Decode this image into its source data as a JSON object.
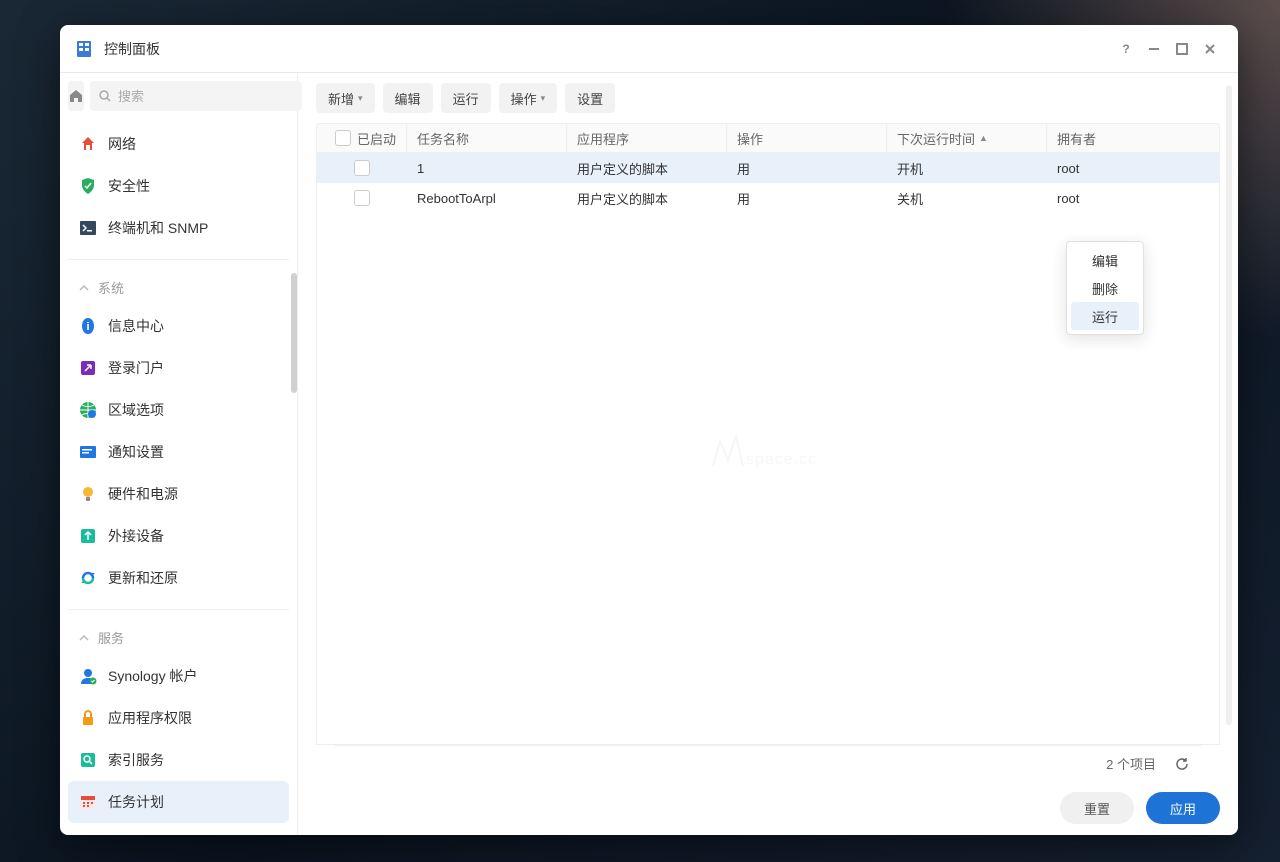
{
  "window": {
    "title": "控制面板"
  },
  "search": {
    "placeholder": "搜索"
  },
  "sidebar": {
    "top": [
      {
        "label": "网络",
        "icon": "home-red"
      },
      {
        "label": "安全性",
        "icon": "shield"
      },
      {
        "label": "终端机和 SNMP",
        "icon": "terminal"
      }
    ],
    "sections": [
      {
        "title": "系统",
        "items": [
          {
            "label": "信息中心",
            "icon": "info"
          },
          {
            "label": "登录门户",
            "icon": "portal"
          },
          {
            "label": "区域选项",
            "icon": "globe"
          },
          {
            "label": "通知设置",
            "icon": "notify"
          },
          {
            "label": "硬件和电源",
            "icon": "bulb"
          },
          {
            "label": "外接设备",
            "icon": "external"
          },
          {
            "label": "更新和还原",
            "icon": "refresh"
          }
        ]
      },
      {
        "title": "服务",
        "items": [
          {
            "label": "Synology 帐户",
            "icon": "account"
          },
          {
            "label": "应用程序权限",
            "icon": "lock"
          },
          {
            "label": "索引服务",
            "icon": "search-svc"
          },
          {
            "label": "任务计划",
            "icon": "calendar",
            "active": true
          }
        ]
      }
    ]
  },
  "toolbar": {
    "new": "新增",
    "edit": "编辑",
    "run": "运行",
    "action": "操作",
    "settings": "设置"
  },
  "table": {
    "headers": {
      "enabled": "已启动",
      "name": "任务名称",
      "app": "应用程序",
      "op": "操作",
      "next": "下次运行时间",
      "owner": "拥有者"
    },
    "rows": [
      {
        "name": "1",
        "app": "用户定义的脚本",
        "op": "用",
        "next": "开机",
        "owner": "root",
        "selected": true
      },
      {
        "name": "RebootToArpl",
        "app": "用户定义的脚本",
        "op": "用",
        "next": "关机",
        "owner": "root",
        "selected": false
      }
    ]
  },
  "context_menu": {
    "items": [
      "编辑",
      "删除",
      "运行"
    ],
    "highlighted_index": 2
  },
  "statusbar": {
    "count_text": "2 个项目"
  },
  "footer": {
    "reset": "重置",
    "apply": "应用"
  },
  "watermark": "mspace.cc"
}
